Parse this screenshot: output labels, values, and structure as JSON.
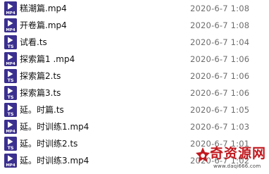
{
  "files": [
    {
      "name": "糕潮篇.mp4",
      "date": "2020-6-7 1:08",
      "icon": "mp4-video-icon",
      "badge": "MP4"
    },
    {
      "name": "开卷篇.mp4",
      "date": "2020-6-7 1:08",
      "icon": "mp4-video-icon",
      "badge": "MP4"
    },
    {
      "name": "试看.ts",
      "date": "2020-6-7 1:04",
      "icon": "ts-video-icon",
      "badge": "TS"
    },
    {
      "name": "探索篇1 .mp4",
      "date": "2020-6-7 1:06",
      "icon": "mp4-video-icon",
      "badge": "MP4"
    },
    {
      "name": "探索篇2.ts",
      "date": "2020-6-7 1:06",
      "icon": "ts-video-icon",
      "badge": "TS"
    },
    {
      "name": "探索篇3.ts",
      "date": "2020-6-7 1:06",
      "icon": "ts-video-icon",
      "badge": "TS"
    },
    {
      "name": "延。时篇.ts",
      "date": "2020-6-7 1:05",
      "icon": "ts-video-icon",
      "badge": "TS"
    },
    {
      "name": "延。时训练1.mp4",
      "date": "2020-6-7 1:03",
      "icon": "mp4-video-icon",
      "badge": "MP4"
    },
    {
      "name": "延。时训练2.ts",
      "date": "2020-6-7 1:01",
      "icon": "ts-video-icon",
      "badge": "TS"
    },
    {
      "name": "延。时训练3.mp4",
      "date": "2020-6-7 1:02",
      "icon": "mp4-video-icon",
      "badge": "MP4"
    }
  ],
  "watermark": {
    "title": "奇资源网",
    "url": "www.daqi666.com",
    "icon": "watermark-logo-icon"
  },
  "colors": {
    "icon_background": "#3b2f8f",
    "icon_play": "#ffffff",
    "date_text": "#6d6d6d",
    "watermark_red": "#c2191f"
  }
}
